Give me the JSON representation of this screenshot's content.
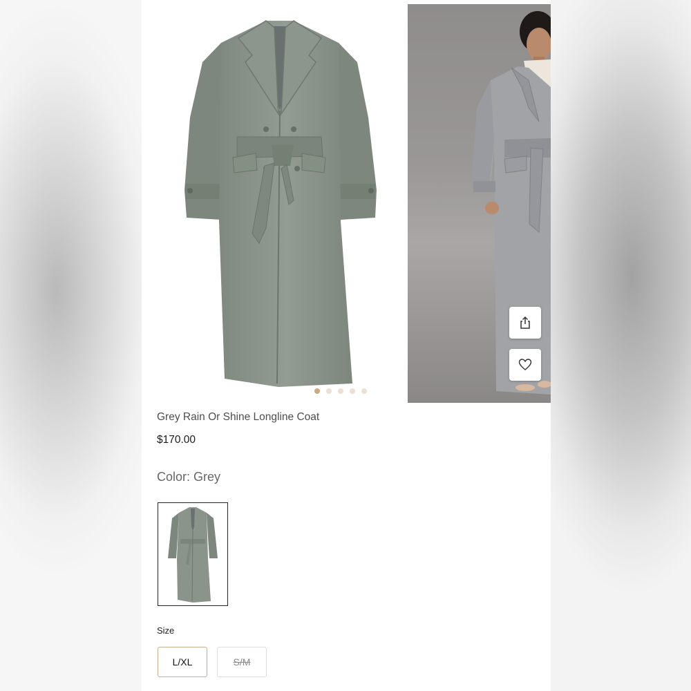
{
  "product": {
    "title": "Grey Rain Or Shine Longline Coat",
    "price": "$170.00",
    "color_label": "Color: Grey"
  },
  "gallery": {
    "dot_count": 5,
    "active_index": 0
  },
  "actions": {
    "share_icon": "share-icon",
    "favorite_icon": "heart-icon"
  },
  "size": {
    "label": "Size",
    "options": [
      {
        "label": "L/XL",
        "selected": true,
        "available": true
      },
      {
        "label": "S/M",
        "selected": false,
        "available": false
      }
    ]
  },
  "colors": {
    "accent": "#cda983",
    "coat_grey": "#8a948a"
  }
}
